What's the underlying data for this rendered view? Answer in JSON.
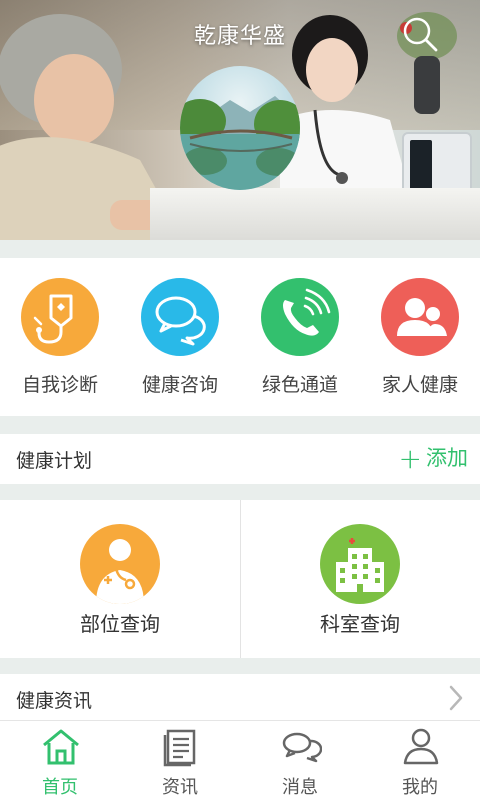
{
  "header": {
    "title": "乾康华盛",
    "search_icon": "search-icon"
  },
  "quick_functions": [
    {
      "label": "自我诊断",
      "icon": "iv-drip-icon",
      "color": "#f7a93b"
    },
    {
      "label": "健康咨询",
      "icon": "chat-bubbles-icon",
      "color": "#29b9e8"
    },
    {
      "label": "绿色通道",
      "icon": "phone-call-icon",
      "color": "#33c06e"
    },
    {
      "label": "家人健康",
      "icon": "family-icon",
      "color": "#ee5f58"
    }
  ],
  "plan": {
    "title": "健康计划",
    "add_label": "添加"
  },
  "queries": [
    {
      "label": "部位查询",
      "icon": "doctor-icon",
      "color": "#f7a93b"
    },
    {
      "label": "科室查询",
      "icon": "hospital-icon",
      "color": "#7cc043"
    }
  ],
  "news": {
    "title": "健康资讯"
  },
  "tabbar": {
    "active": "首页",
    "accent": "#32c06e",
    "tabs": [
      {
        "label": "首页",
        "icon": "home-icon"
      },
      {
        "label": "资讯",
        "icon": "news-icon"
      },
      {
        "label": "消息",
        "icon": "message-icon"
      },
      {
        "label": "我的",
        "icon": "profile-icon"
      }
    ]
  }
}
